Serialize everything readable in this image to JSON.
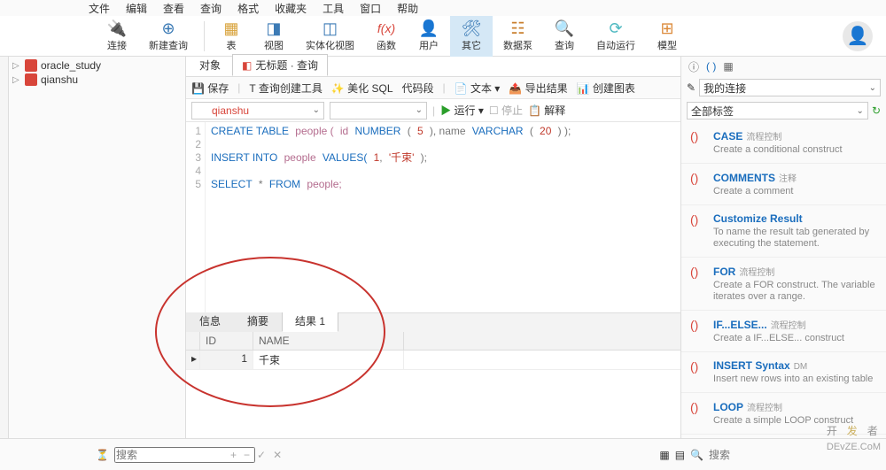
{
  "menu": [
    "文件",
    "编辑",
    "查看",
    "查询",
    "格式",
    "收藏夹",
    "工具",
    "窗口",
    "帮助"
  ],
  "toolbar": [
    {
      "icon": "🔌",
      "label": "连接",
      "color": "#3b7ab5"
    },
    {
      "icon": "⊕",
      "label": "新建查询",
      "color": "#3b7ab5"
    },
    {
      "icon": "▦",
      "label": "表",
      "color": "#d8a23a"
    },
    {
      "icon": "◨",
      "label": "视图",
      "color": "#3b7ab5"
    },
    {
      "icon": "◫",
      "label": "实体化视图",
      "color": "#3b7ab5"
    },
    {
      "icon": "f(x)",
      "label": "函数",
      "color": "#d8453a"
    },
    {
      "icon": "👤",
      "label": "用户",
      "color": "#3b7ab5"
    },
    {
      "icon": "🛠",
      "label": "其它",
      "color": "#3b7ab5",
      "active": true
    },
    {
      "icon": "☷",
      "label": "数据泵",
      "color": "#c97f2e"
    },
    {
      "icon": "🔍",
      "label": "查询",
      "color": "#3b7ab5"
    },
    {
      "icon": "⟳",
      "label": "自动运行",
      "color": "#4fb9c1"
    },
    {
      "icon": "⊞",
      "label": "模型",
      "color": "#dc8a3a"
    }
  ],
  "tree": [
    {
      "name": "oracle_study"
    },
    {
      "name": "qianshu"
    }
  ],
  "tabs": [
    {
      "label": "对象"
    },
    {
      "label": "无标题 · 查询",
      "active": true
    }
  ],
  "qtoolbar": {
    "save": "保存",
    "builder": "查询创建工具",
    "beautify": "美化 SQL",
    "snippet": "代码段",
    "text": "文本 ▾",
    "export": "导出结果",
    "chart": "创建图表"
  },
  "conn": {
    "db": "qianshu",
    "run": "运行 ▾",
    "stop": "停止",
    "explain": "解释"
  },
  "code": {
    "lines": [
      "1",
      "2",
      "3",
      "4",
      "5"
    ],
    "l1_create": "CREATE TABLE",
    "l1_people": "people (",
    "l1_id": "id",
    "l1_number": "NUMBER",
    "l1_p1": "(",
    "l1_five": "5",
    "l1_p2": "), name",
    "l1_varchar": "VARCHAR",
    "l1_p3": "(",
    "l1_twenty": "20",
    "l1_p4": ") );",
    "l3_insert": "INSERT INTO",
    "l3_people": "people",
    "l3_values": "VALUES(",
    "l3_one": "1",
    "l3_c": ",",
    "l3_str": "'千束'",
    "l3_end": ");",
    "l5_select": "SELECT",
    "l5_star": "*",
    "l5_from": "FROM",
    "l5_people": "people;"
  },
  "restabs": [
    "信息",
    "摘要",
    "结果 1"
  ],
  "grid": {
    "cols": [
      "ID",
      "NAME"
    ],
    "row": {
      "id": "1",
      "name": "千束"
    }
  },
  "right": {
    "myconn": "我的连接",
    "alltags": "全部标签",
    "snips": [
      {
        "t": "CASE",
        "tag": "流程控制",
        "d": "Create a conditional construct"
      },
      {
        "t": "COMMENTS",
        "tag": "注释",
        "d": "Create a comment"
      },
      {
        "t": "Customize Result",
        "tag": "",
        "d": "To name the result tab generated by executing the statement."
      },
      {
        "t": "FOR",
        "tag": "流程控制",
        "d": "Create a FOR construct. The variable iterates over a range."
      },
      {
        "t": "IF...ELSE...",
        "tag": "流程控制",
        "d": "Create a IF...ELSE... construct"
      },
      {
        "t": "INSERT Syntax",
        "tag": "DM",
        "d": "Insert new rows into an existing table"
      },
      {
        "t": "LOOP",
        "tag": "流程控制",
        "d": "Create a simple LOOP construct"
      }
    ]
  },
  "footer": {
    "search": "搜索",
    "search2": "搜索"
  },
  "watermark": {
    "a": "开",
    "b": "发",
    "c": "者"
  },
  "devz": "DEvZE.CoM"
}
